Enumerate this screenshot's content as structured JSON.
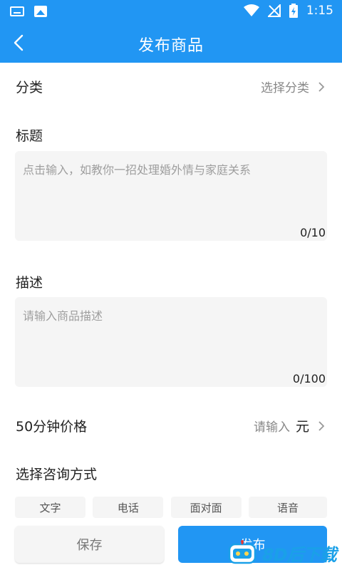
{
  "status_bar": {
    "time": "1:15"
  },
  "header": {
    "title": "发布商品"
  },
  "category": {
    "label": "分类",
    "value": "选择分类"
  },
  "title_field": {
    "label": "标题",
    "placeholder": "点击输入，如教你一招处理婚外情与家庭关系",
    "counter": "0/10"
  },
  "description_field": {
    "label": "描述",
    "placeholder": "请输入商品描述",
    "counter": "0/100"
  },
  "price": {
    "label": "50分钟价格",
    "placeholder": "请输入",
    "unit": "元"
  },
  "consult": {
    "label": "选择咨询方式",
    "options": [
      "文字",
      "电话",
      "面对面",
      "语音"
    ]
  },
  "actions": {
    "save": "保存",
    "publish": "发布"
  },
  "watermark": {
    "text": "8D后下载"
  },
  "colors": {
    "primary": "#2196f3",
    "field_bg": "#f5f5f5"
  }
}
